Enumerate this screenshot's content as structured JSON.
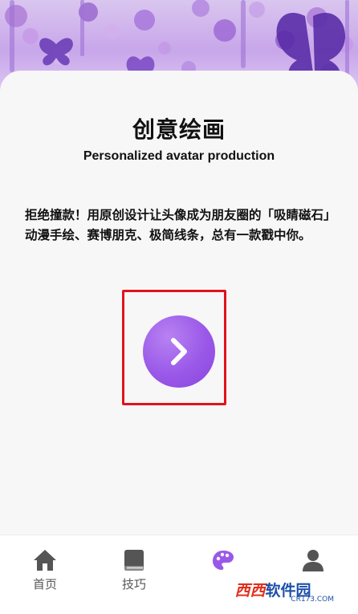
{
  "header": {
    "title": "创意绘画",
    "subtitle": "Personalized avatar production"
  },
  "intro": {
    "description": "拒绝撞款！用原创设计让头像成为朋友圈的「吸睛磁石」 动漫手绘、赛博朋克、极简线条，总有一款戳中你。"
  },
  "start_button": {
    "icon": "chevron-right-icon",
    "color": "#9a58e8"
  },
  "bottom_nav": {
    "items": [
      {
        "label": "首页",
        "icon": "home-icon"
      },
      {
        "label": "技巧",
        "icon": "book-icon"
      },
      {
        "label": "",
        "icon": "palette-icon",
        "active": true
      },
      {
        "label": "",
        "icon": "user-icon"
      }
    ]
  },
  "watermark": {
    "brand_red": "西西",
    "brand_blue": "软件园",
    "url": "CR173.COM"
  },
  "colors": {
    "accent": "#9a58e8",
    "highlight_border": "#e0141b",
    "nav_icon": "#555555"
  }
}
